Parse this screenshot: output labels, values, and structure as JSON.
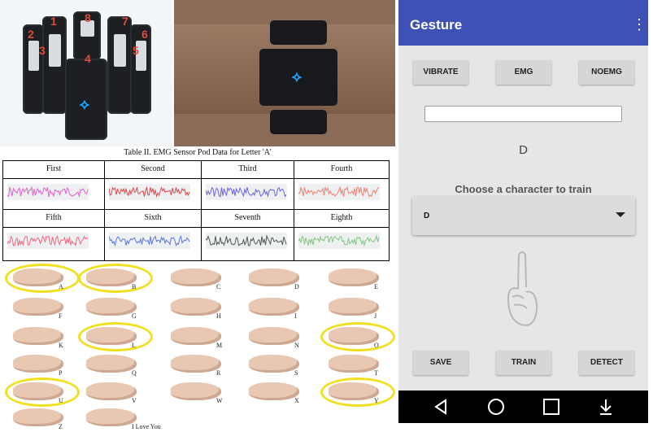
{
  "photos": {
    "pod_numbers": [
      "1",
      "8",
      "7",
      "2",
      "6",
      "3",
      "4",
      "5"
    ]
  },
  "table": {
    "caption": "Table II.  EMG Sensor Pod Data for Letter 'A'",
    "headers_row1": [
      "First",
      "Second",
      "Third",
      "Fourth"
    ],
    "headers_row2": [
      "Fifth",
      "Sixth",
      "Seventh",
      "Eighth"
    ],
    "wave_colors_row1": [
      "#e060d0",
      "#e04848",
      "#7060e0",
      "#f08070"
    ],
    "wave_colors_row2": [
      "#f06880",
      "#5878e0",
      "#505a50",
      "#80c880"
    ]
  },
  "asl": {
    "letters": [
      "A",
      "B",
      "C",
      "D",
      "E",
      "F",
      "G",
      "H",
      "I",
      "J",
      "K",
      "L",
      "M",
      "N",
      "O",
      "P",
      "Q",
      "R",
      "S",
      "T",
      "U",
      "V",
      "W",
      "X",
      "Y",
      "Z",
      "I Love You"
    ],
    "circled": [
      "A",
      "B",
      "L",
      "O",
      "U",
      "Y"
    ]
  },
  "phone": {
    "app_title": "Gesture",
    "buttons_top": [
      "VIBRATE",
      "EMG",
      "NOEMG"
    ],
    "input_value": "",
    "predicted_letter": "D",
    "prompt": "Choose a character to train",
    "spinner_value": "D",
    "buttons_bottom": [
      "SAVE",
      "TRAIN",
      "DETECT"
    ],
    "accent": "#3f51b5"
  }
}
